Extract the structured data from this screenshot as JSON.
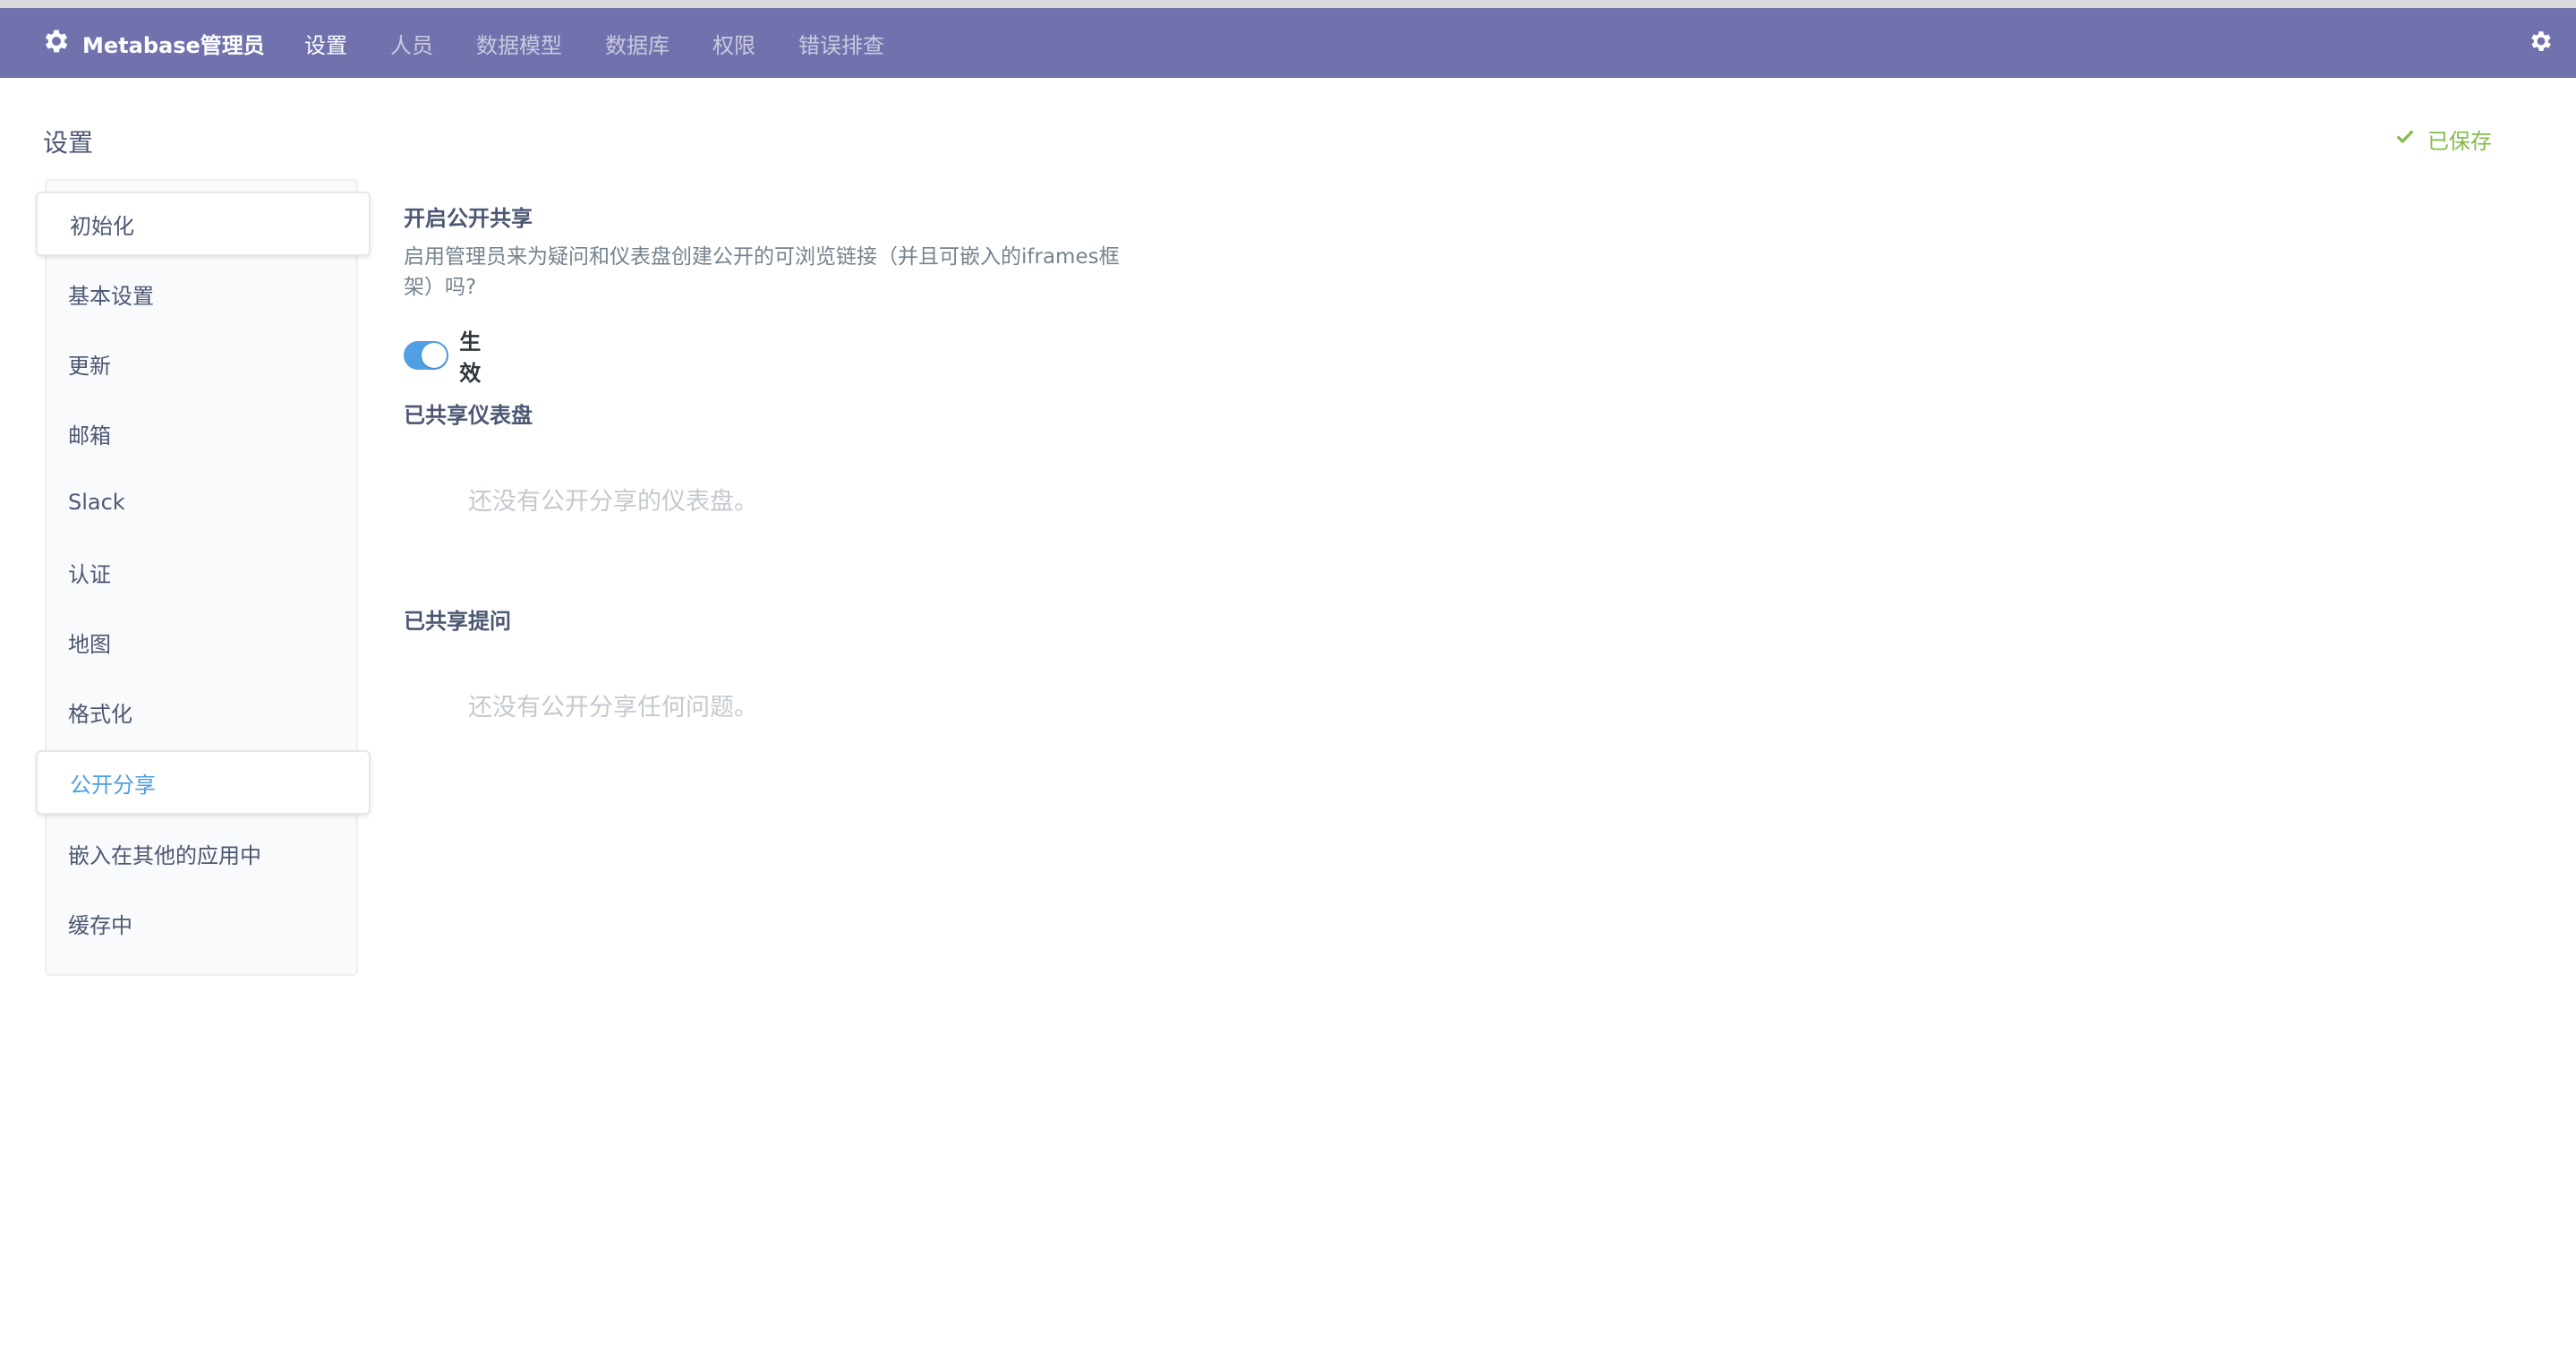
{
  "navbar": {
    "brand": "Metabase管理员",
    "items": [
      {
        "label": "设置",
        "active": true
      },
      {
        "label": "人员",
        "active": false
      },
      {
        "label": "数据模型",
        "active": false
      },
      {
        "label": "数据库",
        "active": false
      },
      {
        "label": "权限",
        "active": false
      },
      {
        "label": "错误排查",
        "active": false
      }
    ],
    "brand_icon": "gear-icon",
    "settings_icon": "gear-icon",
    "background": "#7172ad"
  },
  "page": {
    "title": "设置",
    "saved_status": "已保存",
    "saved_icon": "check-icon",
    "saved_color": "#84bb4c"
  },
  "sidebar": {
    "items": [
      {
        "label": "初始化",
        "selected": false
      },
      {
        "label": "基本设置",
        "selected": false
      },
      {
        "label": "更新",
        "selected": false
      },
      {
        "label": "邮箱",
        "selected": false
      },
      {
        "label": "Slack",
        "selected": false
      },
      {
        "label": "认证",
        "selected": false
      },
      {
        "label": "地图",
        "selected": false
      },
      {
        "label": "格式化",
        "selected": false
      },
      {
        "label": "公开分享",
        "selected": true
      },
      {
        "label": "嵌入在其他的应用中",
        "selected": false
      },
      {
        "label": "缓存中",
        "selected": false
      }
    ],
    "accent": "#509ee3"
  },
  "public_sharing": {
    "title": "开启公开共享",
    "description": "启用管理员来为疑问和仪表盘创建公开的可浏览链接（并且可嵌入的iframes框架）吗?",
    "toggle_on": true,
    "toggle_label": "生效"
  },
  "shared_dashboards": {
    "title": "已共享仪表盘",
    "empty_text": "还没有公开分享的仪表盘。"
  },
  "shared_questions": {
    "title": "已共享提问",
    "empty_text": "还没有公开分享任何问题。"
  }
}
